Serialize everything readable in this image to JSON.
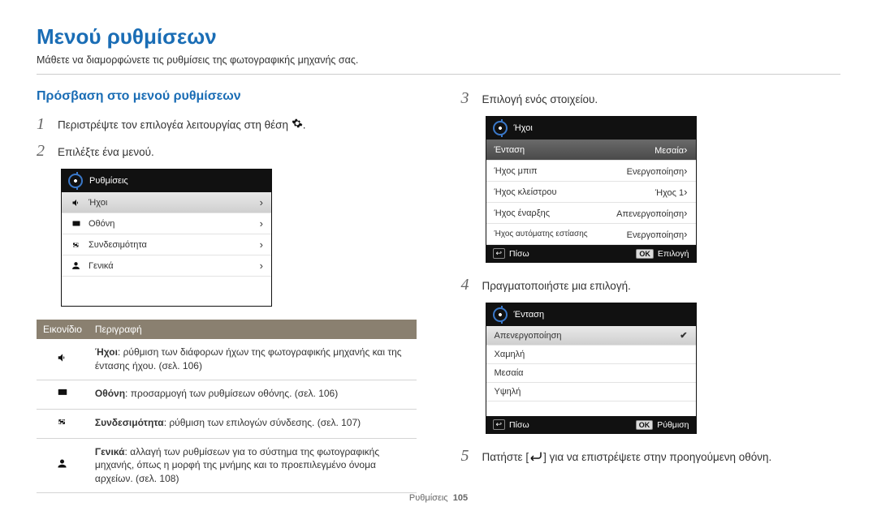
{
  "title": "Μενού ρυθμίσεων",
  "subtitle": "Μάθετε να διαμορφώνετε τις ρυθμίσεις της φωτογραφικής μηχανής σας.",
  "left": {
    "heading": "Πρόσβαση στο μενού ρυθμίσεων",
    "step1": "Περιστρέψτε τον επιλογέα λειτουργίας στη θέση",
    "step2": "Επιλέξτε ένα μενού.",
    "menu1": {
      "title": "Ρυθμίσεις",
      "items": [
        "Ήχοι",
        "Οθόνη",
        "Συνδεσιμότητα",
        "Γενικά"
      ]
    },
    "table": {
      "col_icon": "Εικονίδιο",
      "col_desc": "Περιγραφή",
      "rows": [
        {
          "b": "Ήχοι",
          "t": ": ρύθμιση των διάφορων ήχων της φωτογραφικής μηχανής και της έντασης ήχου. (σελ. 106)"
        },
        {
          "b": "Οθόνη",
          "t": ": προσαρμογή των ρυθμίσεων οθόνης. (σελ. 106)"
        },
        {
          "b": "Συνδεσιμότητα",
          "t": ": ρύθμιση των επιλογών σύνδεσης. (σελ. 107)"
        },
        {
          "b": "Γενικά",
          "t": ": αλλαγή των ρυθμίσεων για το σύστημα της φωτογραφικής μηχανής, όπως η μορφή της μνήμης και το προεπιλεγμένο όνομα αρχείων. (σελ. 108)"
        }
      ]
    }
  },
  "right": {
    "step3": "Επιλογή ενός στοιχείου.",
    "menu2": {
      "title": "Ήχοι",
      "rows": [
        {
          "l": "Ένταση",
          "r": "Μεσαία",
          "sel": true
        },
        {
          "l": "Ήχος μπιπ",
          "r": "Ενεργοποίηση"
        },
        {
          "l": "Ήχος κλείστρου",
          "r": "Ήχος 1"
        },
        {
          "l": "Ήχος έναρξης",
          "r": "Απενεργοποίηση"
        },
        {
          "l": "Ήχος αυτόματης εστίασης",
          "r": "Ενεργοποίηση",
          "small": true
        }
      ],
      "footer_l": "Πίσω",
      "footer_r": "Επιλογή"
    },
    "step4": "Πραγματοποιήστε μια επιλογή.",
    "menu3": {
      "title": "Ένταση",
      "rows": [
        "Απενεργοποίηση",
        "Χαμηλή",
        "Μεσαία",
        "Υψηλή"
      ],
      "selected_index": 0,
      "footer_l": "Πίσω",
      "footer_r": "Ρύθμιση"
    },
    "step5_a": "Πατήστε [",
    "step5_b": "] για να επιστρέψετε στην προηγούμενη οθόνη."
  },
  "footer": {
    "label": "Ρυθμίσεις",
    "page": "105"
  },
  "ok": "OK"
}
